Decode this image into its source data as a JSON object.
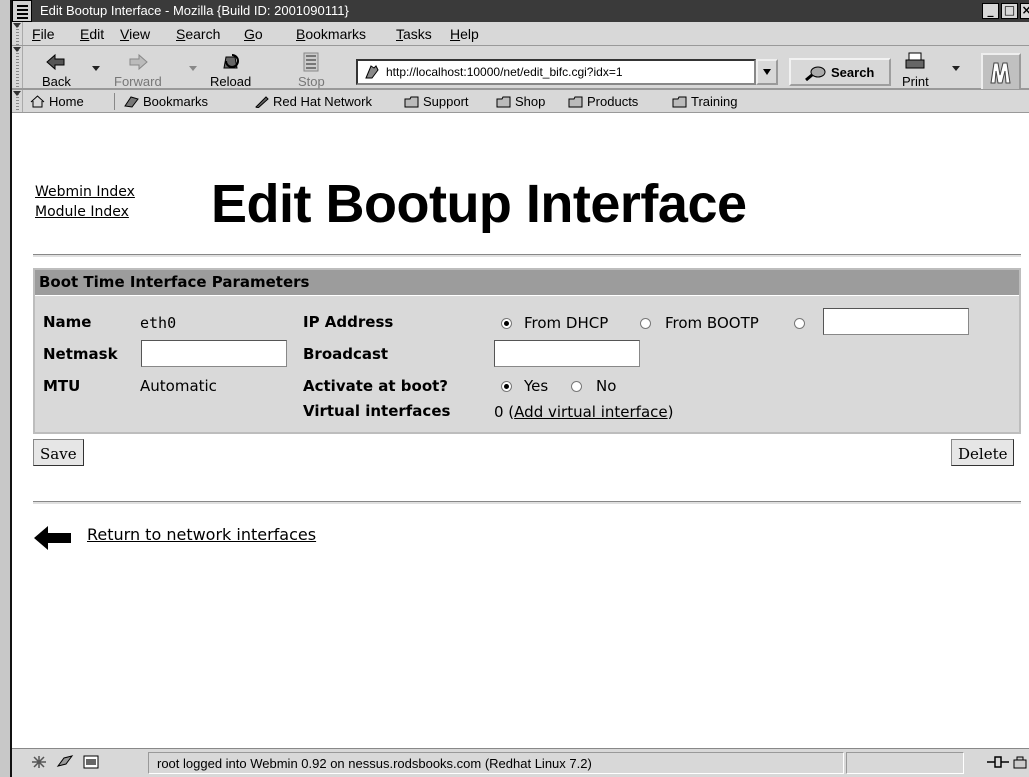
{
  "window": {
    "title": "Edit Bootup Interface - Mozilla {Build ID: 2001090111}"
  },
  "menu": [
    "File",
    "Edit",
    "View",
    "Search",
    "Go",
    "Bookmarks",
    "Tasks",
    "Help"
  ],
  "toolbar": {
    "back": "Back",
    "forward": "Forward",
    "reload": "Reload",
    "stop": "Stop",
    "url": "http://localhost:10000/net/edit_bifc.cgi?idx=1",
    "search": "Search",
    "print": "Print"
  },
  "personal_toolbar": [
    "Home",
    "Bookmarks",
    "Red Hat Network",
    "Support",
    "Shop",
    "Products",
    "Training"
  ],
  "page": {
    "links": {
      "webmin_index": "Webmin Index",
      "module_index": "Module Index"
    },
    "title": "Edit Bootup Interface",
    "panel": {
      "heading": "Boot Time Interface Parameters",
      "name_label": "Name",
      "name_value": "eth0",
      "netmask_label": "Netmask",
      "netmask_value": "",
      "mtu_label": "MTU",
      "mtu_value": "Automatic",
      "ip_label": "IP Address",
      "ip_options": [
        "From DHCP",
        "From BOOTP"
      ],
      "ip_selected": "From DHCP",
      "ip_value": "",
      "broadcast_label": "Broadcast",
      "broadcast_value": "",
      "activate_label": "Activate at boot?",
      "activate_options": [
        "Yes",
        "No"
      ],
      "activate_selected": "Yes",
      "virtual_label": "Virtual interfaces",
      "virtual_count": "0 (",
      "virtual_link": "Add virtual interface",
      "virtual_close": ")"
    },
    "buttons": {
      "save": "Save",
      "delete": "Delete"
    },
    "return_link": "Return to network interfaces"
  },
  "status": {
    "message": "root logged into Webmin 0.92 on nessus.rodsbooks.com (Redhat Linux 7.2)"
  }
}
